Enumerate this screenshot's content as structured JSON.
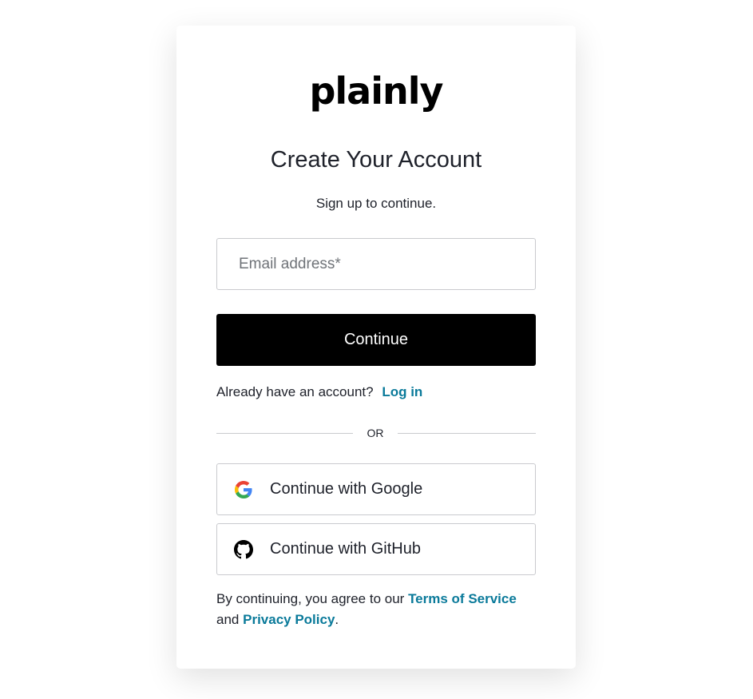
{
  "logo": {
    "text": "plainly"
  },
  "heading": {
    "title": "Create Your Account",
    "subtitle": "Sign up to continue."
  },
  "form": {
    "email_placeholder": "Email address*",
    "email_value": "",
    "continue_label": "Continue"
  },
  "login": {
    "prompt": "Already have an account?",
    "link_label": "Log in"
  },
  "divider": {
    "text": "OR"
  },
  "social": {
    "google": {
      "label": "Continue with Google",
      "icon": "google-icon"
    },
    "github": {
      "label": "Continue with GitHub",
      "icon": "github-icon"
    }
  },
  "terms": {
    "prefix": "By continuing, you agree to our",
    "tos_label": "Terms of Service",
    "middle": "and",
    "privacy_label": "Privacy Policy",
    "suffix": "."
  },
  "colors": {
    "link": "#0a7a9a",
    "primary_button": "#000000",
    "border": "#c9cace",
    "text": "#1e212a"
  }
}
